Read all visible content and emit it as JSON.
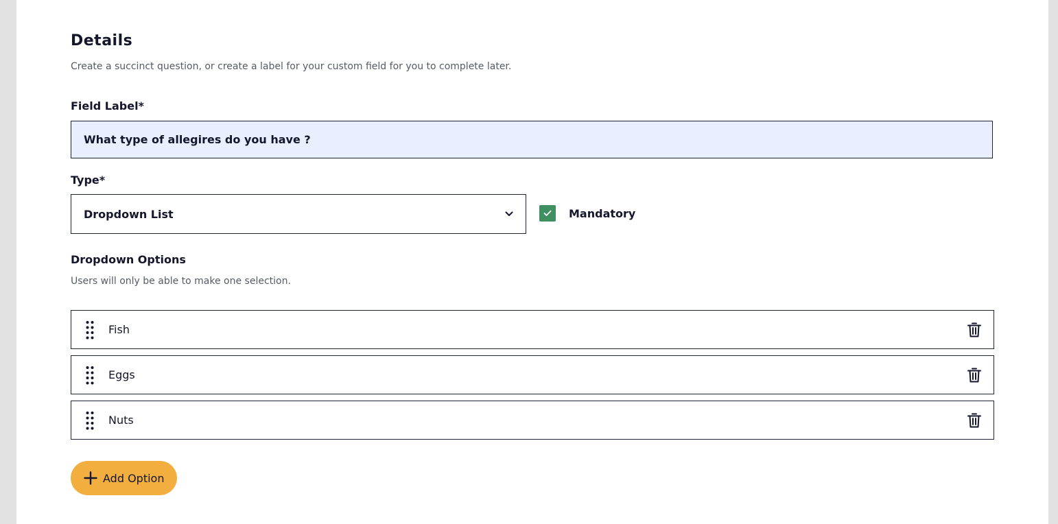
{
  "details": {
    "title": "Details",
    "description": "Create a succinct question, or create a label for your custom field for you to complete later."
  },
  "field_label": {
    "label": "Field Label",
    "required_marker": "*",
    "value": "What type of allegires do you have ?"
  },
  "type": {
    "label": "Type",
    "required_marker": "*",
    "selected": "Dropdown List",
    "icon": "chevron-down-icon"
  },
  "mandatory": {
    "label": "Mandatory",
    "checked": true,
    "color": "#3f8f63"
  },
  "dropdown_options": {
    "title": "Dropdown Options",
    "description": "Users will only be able to make one selection.",
    "items": [
      {
        "label": "Fish"
      },
      {
        "label": "Eggs"
      },
      {
        "label": "Nuts"
      }
    ],
    "add_button_label": "Add Option",
    "add_button_color": "#f2ae3f"
  }
}
